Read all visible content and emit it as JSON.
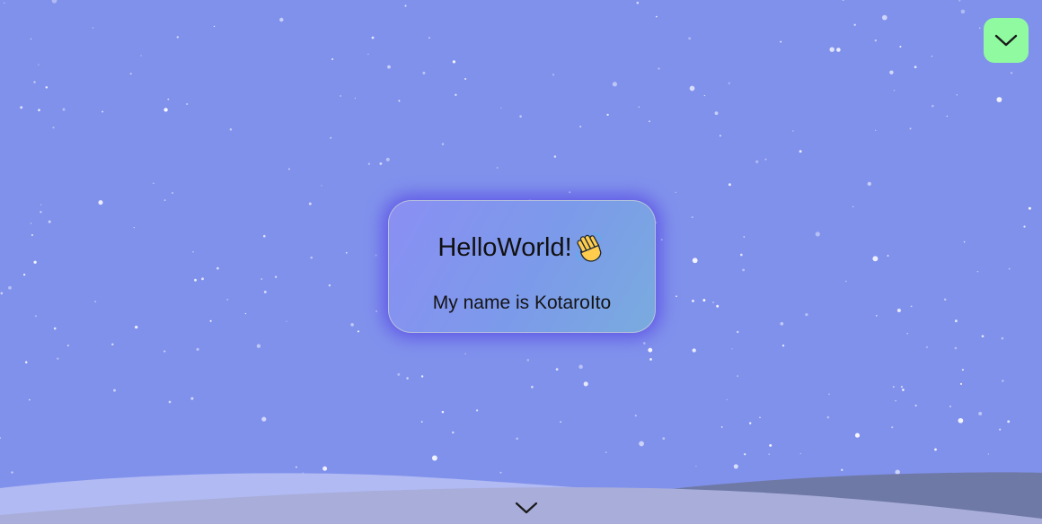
{
  "colors": {
    "background": "#8091ec",
    "menu_button": "#8ffa9f",
    "hill_back": "#6f79a6",
    "hill_front": "#a8add9",
    "hill_light": "#b1baf3",
    "card_glow": "#5c50e4"
  },
  "header": {
    "menu_icon": "chevron-down-icon"
  },
  "card": {
    "title": "HelloWorld!",
    "title_emoji": "waving-hand-icon",
    "subtitle": "My name is KotaroIto"
  },
  "footer": {
    "scroll_icon": "chevron-down-icon"
  }
}
